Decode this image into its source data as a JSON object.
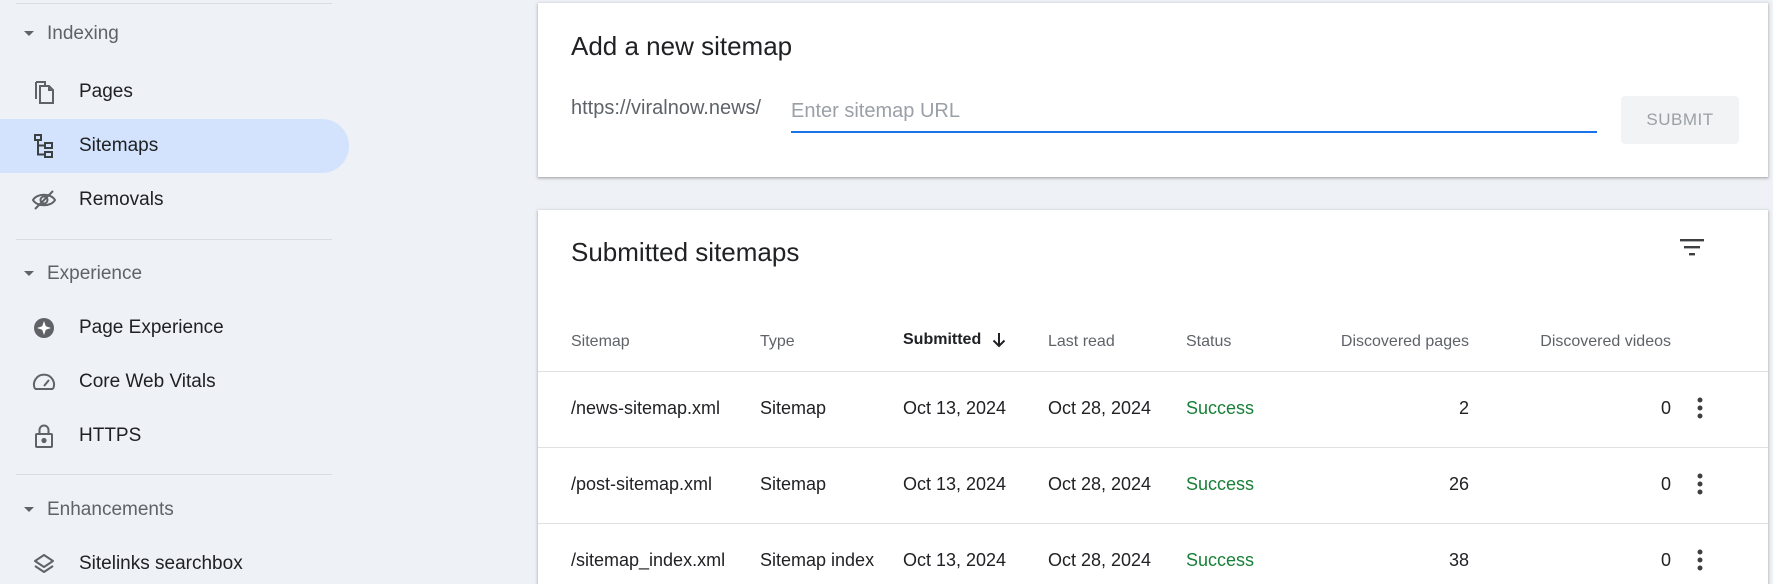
{
  "sidebar": {
    "sections": [
      {
        "label": "Indexing"
      },
      {
        "label": "Experience"
      },
      {
        "label": "Enhancements"
      }
    ],
    "items": [
      {
        "label": "Pages",
        "icon": "pages-icon"
      },
      {
        "label": "Sitemaps",
        "icon": "sitemaps-icon",
        "active": true
      },
      {
        "label": "Removals",
        "icon": "removals-icon"
      },
      {
        "label": "Page Experience",
        "icon": "page-experience-icon"
      },
      {
        "label": "Core Web Vitals",
        "icon": "core-web-vitals-icon"
      },
      {
        "label": "HTTPS",
        "icon": "lock-icon"
      },
      {
        "label": "Sitelinks searchbox",
        "icon": "layers-icon"
      }
    ]
  },
  "add_sitemap": {
    "title": "Add a new sitemap",
    "prefix": "https://viralnow.news/",
    "input_value": "",
    "placeholder": "Enter sitemap URL",
    "submit_label": "SUBMIT"
  },
  "submitted": {
    "title": "Submitted sitemaps",
    "columns": {
      "sitemap": "Sitemap",
      "type": "Type",
      "submitted": "Submitted",
      "last_read": "Last read",
      "status": "Status",
      "discovered_pages": "Discovered pages",
      "discovered_videos": "Discovered videos"
    },
    "rows": [
      {
        "sitemap": "/news-sitemap.xml",
        "type": "Sitemap",
        "submitted": "Oct 13, 2024",
        "last_read": "Oct 28, 2024",
        "status": "Success",
        "pages": "2",
        "videos": "0"
      },
      {
        "sitemap": "/post-sitemap.xml",
        "type": "Sitemap",
        "submitted": "Oct 13, 2024",
        "last_read": "Oct 28, 2024",
        "status": "Success",
        "pages": "26",
        "videos": "0"
      },
      {
        "sitemap": "/sitemap_index.xml",
        "type": "Sitemap index",
        "submitted": "Oct 13, 2024",
        "last_read": "Oct 28, 2024",
        "status": "Success",
        "pages": "38",
        "videos": "0"
      }
    ]
  },
  "colors": {
    "accent": "#1a73e8",
    "active_nav": "#d3e3fd",
    "success": "#188038",
    "background": "#eef1f6"
  }
}
